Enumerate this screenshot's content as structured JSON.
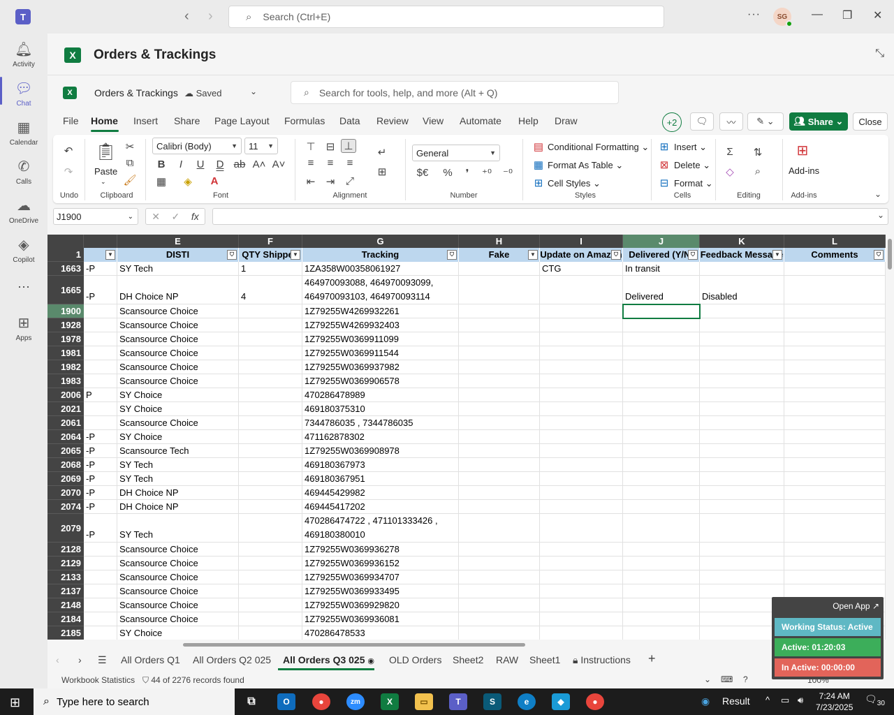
{
  "teams": {
    "search_placeholder": "Search (Ctrl+E)",
    "avatar_initials": "SG",
    "rail": [
      {
        "label": "Activity",
        "icon": "bell-icon"
      },
      {
        "label": "Chat",
        "icon": "chat-icon"
      },
      {
        "label": "Calendar",
        "icon": "calendar-icon"
      },
      {
        "label": "Calls",
        "icon": "phone-icon"
      },
      {
        "label": "OneDrive",
        "icon": "cloud-icon"
      },
      {
        "label": "Copilot",
        "icon": "copilot-icon"
      },
      {
        "label": "Apps",
        "icon": "apps-plus-icon"
      }
    ]
  },
  "app": {
    "title": "Orders & Trackings"
  },
  "excel": {
    "workbook_name": "Orders & Trackings",
    "saved_label": "Saved",
    "tool_search": "Search for tools, help, and more (Alt + Q)",
    "tabs": [
      "File",
      "Home",
      "Insert",
      "Share",
      "Page Layout",
      "Formulas",
      "Data",
      "Review",
      "View",
      "Automate",
      "Help",
      "Draw"
    ],
    "active_tab": "Home",
    "collaborators": "+2",
    "share_label": "Share",
    "close_label": "Close"
  },
  "ribbon": {
    "undo_label": "Undo",
    "paste_label": "Paste",
    "clipboard_label": "Clipboard",
    "font_name": "Calibri (Body)",
    "font_size": "11",
    "font_label": "Font",
    "alignment_label": "Alignment",
    "number_format": "General",
    "number_label": "Number",
    "conditional_formatting": "Conditional Formatting",
    "format_as_table": "Format As Table",
    "cell_styles": "Cell Styles",
    "styles_label": "Styles",
    "insert": "Insert",
    "delete": "Delete",
    "format": "Format",
    "cells_label": "Cells",
    "editing_label": "Editing",
    "addins": "Add-ins",
    "addins_label": "Add-ins"
  },
  "formula_bar": {
    "name_box": "J1900",
    "formula": ""
  },
  "grid": {
    "columns": [
      {
        "letter": "",
        "header": "",
        "w": 48
      },
      {
        "letter": "E",
        "header": "DISTI",
        "w": 174
      },
      {
        "letter": "F",
        "header": "QTY Shipped",
        "w": 91
      },
      {
        "letter": "G",
        "header": "Tracking",
        "w": 224
      },
      {
        "letter": "H",
        "header": "Fake",
        "w": 116
      },
      {
        "letter": "I",
        "header": "Update on Amazon",
        "w": 119
      },
      {
        "letter": "J",
        "header": "Delivered (Y/N)",
        "w": 110
      },
      {
        "letter": "K",
        "header": "Feedback Message",
        "w": 121
      },
      {
        "letter": "L",
        "header": "Comments",
        "w": 145
      }
    ],
    "header_row": "1",
    "rows": [
      {
        "n": "1663",
        "c": [
          "-P",
          "SY Tech",
          "1",
          "1ZA358W00358061927",
          "",
          "CTG",
          "In transit",
          "",
          ""
        ]
      },
      {
        "n": "1665",
        "tall": true,
        "c": [
          "-P",
          "DH Choice NP",
          "4",
          "464970093088, 464970093099,\n464970093103, 464970093114",
          "",
          "",
          "Delivered",
          "Disabled",
          ""
        ]
      },
      {
        "n": "1900",
        "c": [
          "",
          "Scansource Choice",
          "",
          "1Z79255W4269932261",
          "",
          "",
          "",
          "",
          ""
        ]
      },
      {
        "n": "1928",
        "c": [
          "",
          "Scansource Choice",
          "",
          "1Z79255W4269932403",
          "",
          "",
          "",
          "",
          ""
        ]
      },
      {
        "n": "1978",
        "c": [
          "",
          "Scansource Choice",
          "",
          "1Z79255W0369911099",
          "",
          "",
          "",
          "",
          ""
        ]
      },
      {
        "n": "1981",
        "c": [
          "",
          "Scansource Choice",
          "",
          "1Z79255W0369911544",
          "",
          "",
          "",
          "",
          ""
        ]
      },
      {
        "n": "1982",
        "c": [
          "",
          "Scansource Choice",
          "",
          "1Z79255W0369937982",
          "",
          "",
          "",
          "",
          ""
        ]
      },
      {
        "n": "1983",
        "c": [
          "",
          "Scansource Choice",
          "",
          "1Z79255W0369906578",
          "",
          "",
          "",
          "",
          ""
        ]
      },
      {
        "n": "2006",
        "c": [
          "P",
          "SY Choice",
          "",
          "470286478989",
          "",
          "",
          "",
          "",
          ""
        ]
      },
      {
        "n": "2021",
        "c": [
          "",
          "SY Choice",
          "",
          "469180375310",
          "",
          "",
          "",
          "",
          ""
        ]
      },
      {
        "n": "2061",
        "c": [
          "",
          "Scansource Choice",
          "",
          "7344786035 , 7344786035",
          "",
          "",
          "",
          "",
          ""
        ]
      },
      {
        "n": "2064",
        "c": [
          "-P",
          "SY Choice",
          "",
          "471162878302",
          "",
          "",
          "",
          "",
          ""
        ]
      },
      {
        "n": "2065",
        "c": [
          "-P",
          "Scansource Tech",
          "",
          "1Z79255W0369908978",
          "",
          "",
          "",
          "",
          ""
        ]
      },
      {
        "n": "2068",
        "c": [
          "-P",
          "SY Tech",
          "",
          "469180367973",
          "",
          "",
          "",
          "",
          ""
        ]
      },
      {
        "n": "2069",
        "c": [
          "-P",
          "SY Tech",
          "",
          "469180367951",
          "",
          "",
          "",
          "",
          ""
        ]
      },
      {
        "n": "2070",
        "c": [
          "-P",
          "DH Choice NP",
          "",
          "469445429982",
          "",
          "",
          "",
          "",
          ""
        ]
      },
      {
        "n": "2074",
        "c": [
          "-P",
          "DH Choice NP",
          "",
          "469445417202",
          "",
          "",
          "",
          "",
          ""
        ]
      },
      {
        "n": "2079",
        "tall": true,
        "c": [
          "-P",
          "SY Tech",
          "",
          "470286474722 , 471101333426 ,\n469180380010",
          "",
          "",
          "",
          "",
          ""
        ]
      },
      {
        "n": "2128",
        "c": [
          "",
          "Scansource Choice",
          "",
          "1Z79255W0369936278",
          "",
          "",
          "",
          "",
          ""
        ]
      },
      {
        "n": "2129",
        "c": [
          "",
          "Scansource Choice",
          "",
          "1Z79255W0369936152",
          "",
          "",
          "",
          "",
          ""
        ]
      },
      {
        "n": "2133",
        "c": [
          "",
          "Scansource Choice",
          "",
          "1Z79255W0369934707",
          "",
          "",
          "",
          "",
          ""
        ]
      },
      {
        "n": "2137",
        "c": [
          "",
          "Scansource Choice",
          "",
          "1Z79255W0369933495",
          "",
          "",
          "",
          "",
          ""
        ]
      },
      {
        "n": "2148",
        "c": [
          "",
          "Scansource Choice",
          "",
          "1Z79255W0369929820",
          "",
          "",
          "",
          "",
          ""
        ]
      },
      {
        "n": "2184",
        "c": [
          "",
          "Scansource Choice",
          "",
          "1Z79255W0369936081",
          "",
          "",
          "",
          "",
          ""
        ]
      },
      {
        "n": "2185",
        "c": [
          "",
          "SY Choice",
          "",
          "470286478533",
          "",
          "",
          "",
          "",
          ""
        ]
      }
    ]
  },
  "sheets": [
    {
      "name": "All Orders Q1"
    },
    {
      "name": "All Orders Q2 025"
    },
    {
      "name": "All Orders Q3 025",
      "active": true
    },
    {
      "name": "OLD Orders"
    },
    {
      "name": "Sheet2"
    },
    {
      "name": "RAW"
    },
    {
      "name": "Sheet1"
    },
    {
      "name": "Instructions",
      "locked": true
    }
  ],
  "status": {
    "workbook_statistics": "Workbook Statistics",
    "filter_count": "44 of 2276 records found",
    "zoom": "100%"
  },
  "widget": {
    "open_app": "Open App",
    "working_status": "Working Status: Active",
    "active_time": "Active: 01:20:03",
    "inactive_time": "In Active: 00:00:00",
    "colors": {
      "status": "#5fb8c4",
      "active": "#3cae5a",
      "inactive": "#e2645a"
    }
  },
  "taskbar": {
    "search_placeholder": "Type here to search",
    "result_label": "Result",
    "time": "7:24 AM",
    "date": "7/23/2025",
    "notifications": "30"
  }
}
